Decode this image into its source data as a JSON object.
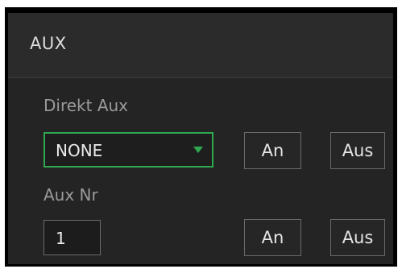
{
  "panel": {
    "title": "AUX"
  },
  "direct_aux": {
    "label": "Direkt Aux",
    "selected": "NONE",
    "on_label": "An",
    "off_label": "Aus"
  },
  "aux_nr": {
    "label": "Aux Nr",
    "value": "1",
    "on_label": "An",
    "off_label": "Aus"
  },
  "colors": {
    "accent": "#2fa84f",
    "background": "#242424"
  }
}
